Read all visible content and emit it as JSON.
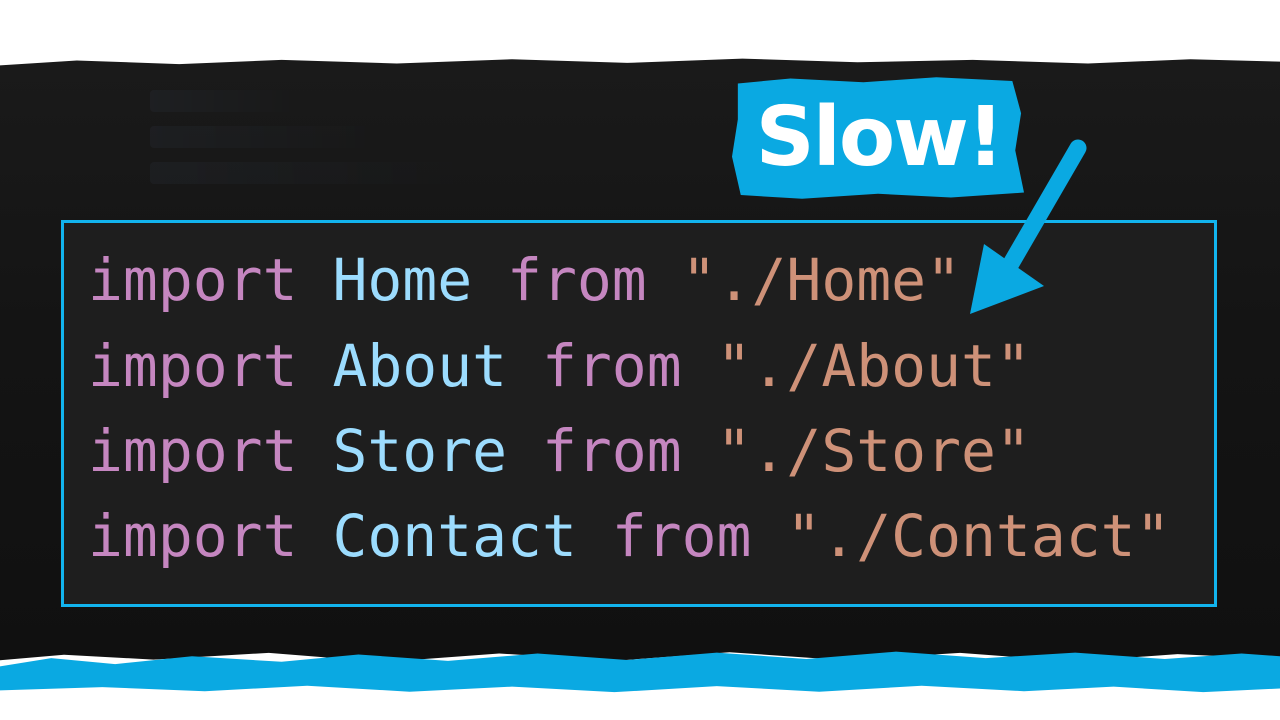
{
  "badge": {
    "text": "Slow!",
    "color": "#0aa9e2"
  },
  "code": {
    "lines": [
      {
        "keyword": "import",
        "identifier": "Home",
        "from": "from",
        "path": "\"./Home\""
      },
      {
        "keyword": "import",
        "identifier": "About",
        "from": "from",
        "path": "\"./About\""
      },
      {
        "keyword": "import",
        "identifier": "Store",
        "from": "from",
        "path": "\"./Store\""
      },
      {
        "keyword": "import",
        "identifier": "Contact",
        "from": "from",
        "path": "\"./Contact\""
      }
    ]
  },
  "colors": {
    "accent": "#12b4ee",
    "keyword": "#c586c0",
    "identifier": "#9cdcfe",
    "string": "#ce9178",
    "code_background": "#1e1e1e"
  },
  "icons": {
    "arrow": "arrow-down-left-icon"
  }
}
